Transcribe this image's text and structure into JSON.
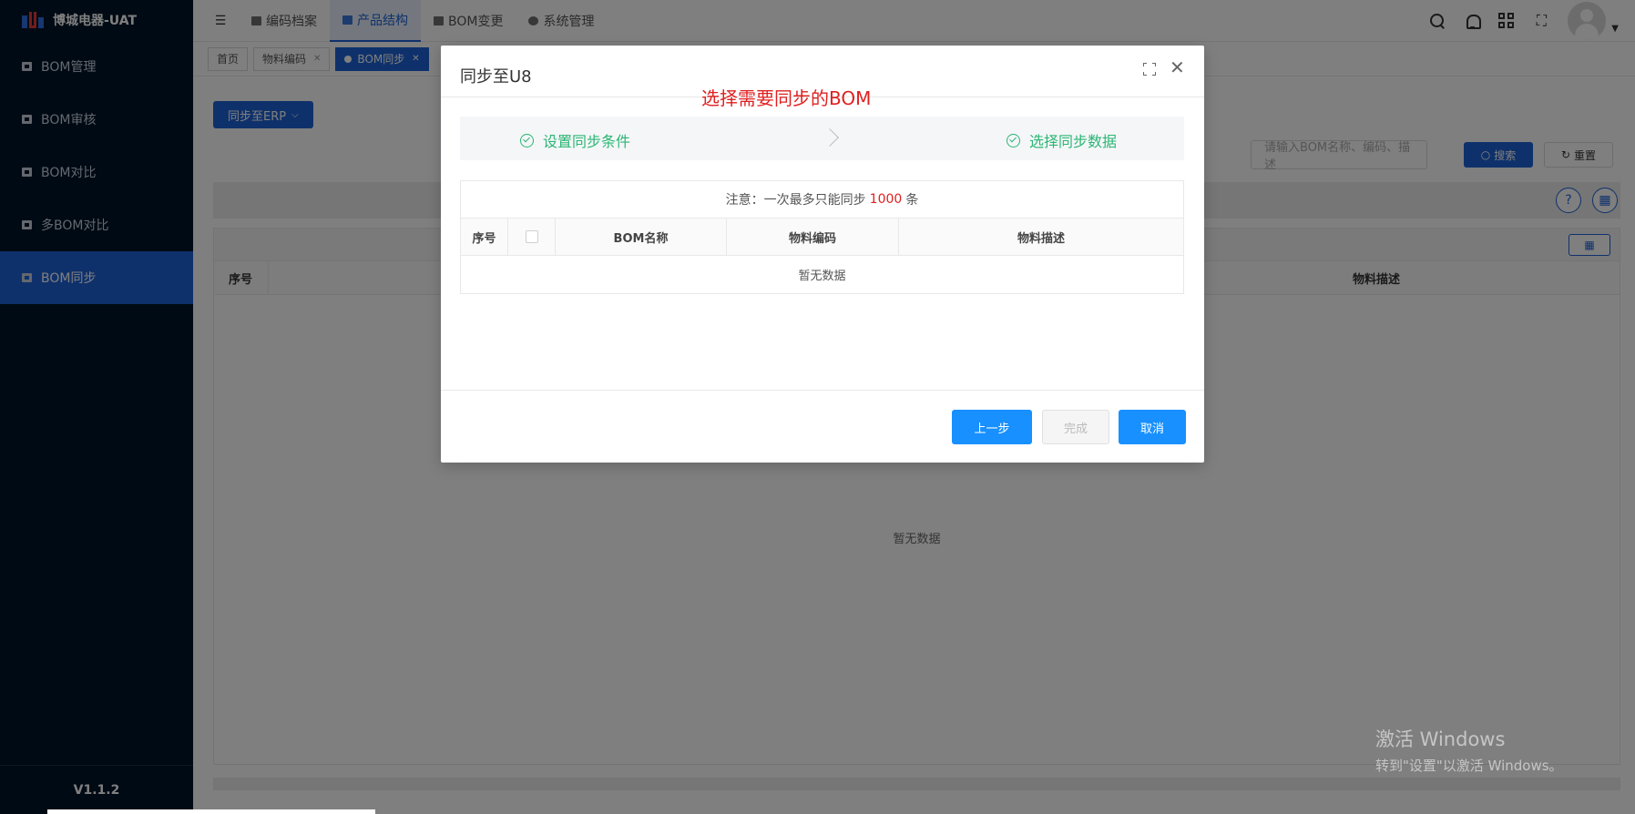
{
  "app": {
    "title": "博城电器-UAT",
    "version": "V1.1.2"
  },
  "sidebar": {
    "items": [
      {
        "label": "BOM管理"
      },
      {
        "label": "BOM审核"
      },
      {
        "label": "BOM对比"
      },
      {
        "label": "多BOM对比"
      },
      {
        "label": "BOM同步",
        "active": true
      }
    ]
  },
  "topnav": {
    "items": [
      {
        "label": "编码档案"
      },
      {
        "label": "产品结构",
        "active": true
      },
      {
        "label": "BOM变更"
      },
      {
        "label": "系统管理"
      }
    ]
  },
  "tabs": [
    {
      "label": "首页"
    },
    {
      "label": "物料编码"
    },
    {
      "label": "BOM同步",
      "active": true
    }
  ],
  "main": {
    "erp_button": "同步至ERP",
    "search_placeholder": "请输入BOM名称、编码、描述",
    "search_button": "搜索",
    "reset_button": "重置",
    "table": {
      "col_seq": "序号",
      "col_desc": "物料描述",
      "empty": "暂无数据"
    }
  },
  "modal": {
    "title": "同步至U8",
    "annotation": "选择需要同步的BOM",
    "steps": [
      {
        "label": "设置同步条件"
      },
      {
        "label": "选择同步数据"
      }
    ],
    "note_prefix": "注意：一次最多只能同步",
    "note_count": "1000",
    "note_suffix": "条",
    "columns": {
      "seq": "序号",
      "bom_name": "BOM名称",
      "code": "物料编码",
      "desc": "物料描述"
    },
    "empty": "暂无数据",
    "buttons": {
      "prev": "上一步",
      "finish": "完成",
      "cancel": "取消"
    }
  },
  "watermark": {
    "line1": "激活 Windows",
    "line2": "转到\"设置\"以激活 Windows。"
  },
  "colors": {
    "primary": "#1e62d6",
    "sidebar_bg": "#001529",
    "step_green": "#2bb673",
    "annotation_red": "#e02020"
  }
}
